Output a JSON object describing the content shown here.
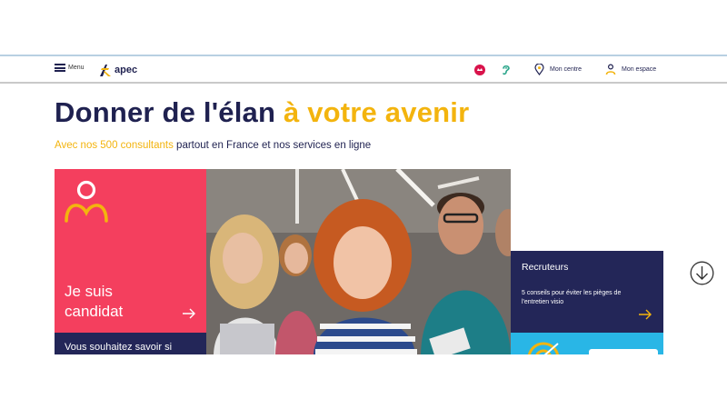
{
  "header": {
    "menu_label": "Menu",
    "logo_text": "apec",
    "links": [
      {
        "label": "Mon centre",
        "icon": "map-pin-icon"
      },
      {
        "label": "Mon espace",
        "icon": "user-icon"
      }
    ],
    "icons": [
      "language-flag-icon",
      "hearing-accessibility-icon"
    ]
  },
  "hero": {
    "title_main": "Donner de l'élan ",
    "title_accent": "à votre avenir",
    "subtitle_accent": "Avec nos 500 consultants",
    "subtitle_rest": " partout en France et nos services en ligne"
  },
  "candidate_card": {
    "title": "Je suis candidat",
    "strip_text": "Vous souhaitez savoir si"
  },
  "recruiter_card": {
    "title": "Recruteurs",
    "description": "5 conseils pour éviter les pièges de l'entretien visio"
  },
  "colors": {
    "navy": "#1f2150",
    "accent_yellow": "#f3b40e",
    "candidate_pink": "#f43f5e",
    "recruiter_navy": "#232658",
    "light_blue": "#29b6e6"
  }
}
